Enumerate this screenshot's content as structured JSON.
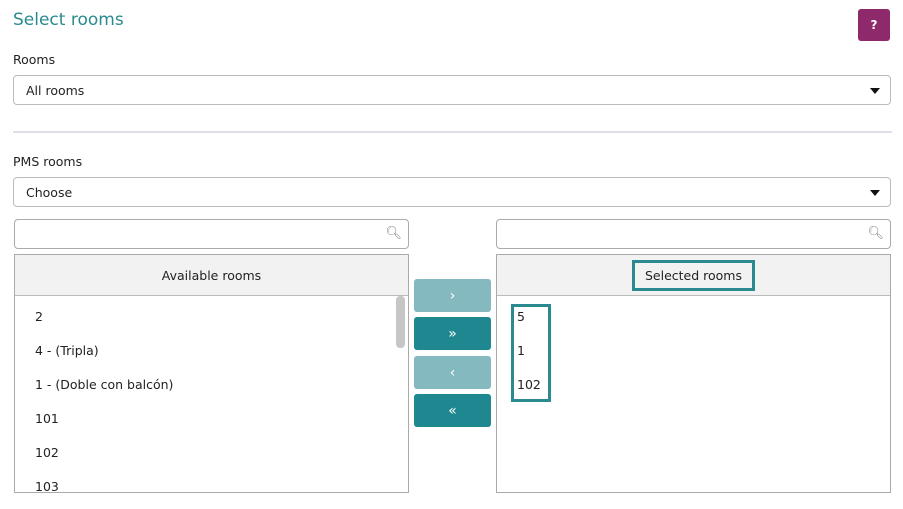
{
  "title": "Select rooms",
  "help_label": "?",
  "rooms": {
    "label": "Rooms",
    "value": "All rooms"
  },
  "pms_rooms": {
    "label": "PMS rooms",
    "value": "Choose"
  },
  "available": {
    "header": "Available rooms",
    "search_value": "",
    "items": [
      "2",
      "4 - (Tripla)",
      "1 - (Doble con balcón)",
      "101",
      "102",
      "103"
    ]
  },
  "selected": {
    "header": "Selected rooms",
    "search_value": "",
    "items": [
      "5",
      "1",
      "102"
    ]
  },
  "buttons": {
    "move_one": "›",
    "move_all": "»",
    "remove_one": "‹",
    "remove_all": "«"
  },
  "colors": {
    "accent": "#1e8790",
    "accent_light": "#84b9bf",
    "help": "#8e2a6b"
  }
}
